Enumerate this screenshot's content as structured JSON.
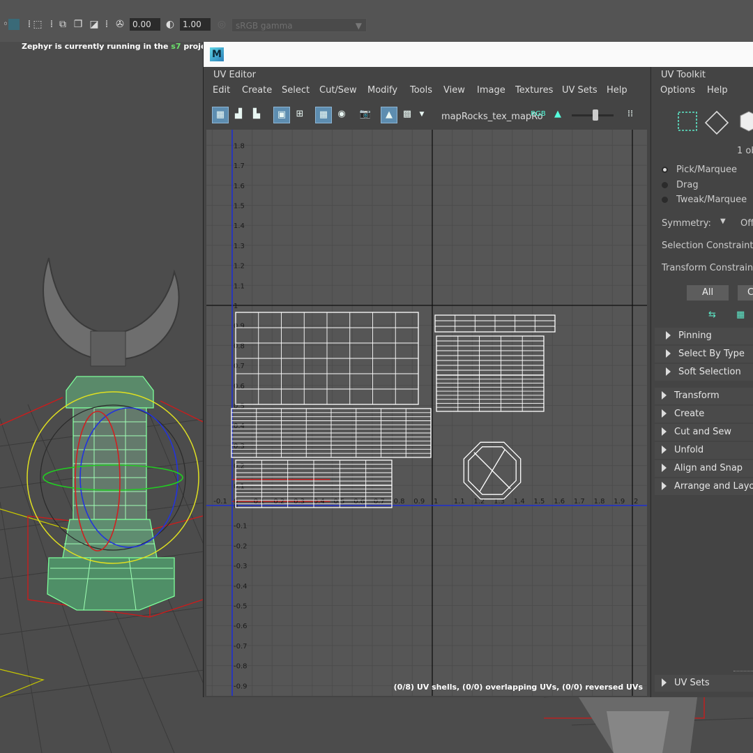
{
  "toolbar": {
    "value_a": "0.00",
    "value_b": "1.00",
    "color_space": "sRGB gamma"
  },
  "viewport": {
    "hud_message_pre": "Zephyr is currently running in the ",
    "hud_message_project": "s7",
    "hud_message_post": " project"
  },
  "uv_editor": {
    "title": "UV Editor",
    "menus": [
      "Edit",
      "Create",
      "Select",
      "Cut/Sew",
      "Modify",
      "Tools",
      "View",
      "Image",
      "Textures",
      "UV Sets",
      "Help"
    ],
    "texture_name": "mapRocks_tex_mapRo",
    "status": "(0/8) UV shells, (0/0) overlapping UVs, (0/0) reversed UVs",
    "v_axis_labels": [
      "1.8",
      "1.7",
      "1.6",
      "1.5",
      "1.4",
      "1.3",
      "1.2",
      "1.1",
      "1",
      "0.9",
      "0.8",
      "0.7",
      "0.6",
      "0.5",
      "0.4",
      "0.3",
      "0.2",
      "0.1",
      "0",
      "-0.1",
      "-0.2",
      "-0.3",
      "-0.4",
      "-0.5",
      "-0.6",
      "-0.7",
      "-0.8",
      "-0.9"
    ],
    "u_axis_labels": [
      "-0.1",
      "0",
      "0.1",
      "0.2",
      "0.3",
      "0.4",
      "0.5",
      "0.6",
      "0.7",
      "0.8",
      "0.9",
      "1",
      "1.1",
      "1.2",
      "1.3",
      "1.4",
      "1.5",
      "1.6",
      "1.7",
      "1.8",
      "1.9",
      "2"
    ]
  },
  "uv_toolkit": {
    "title": "UV Toolkit",
    "menus": [
      "Options",
      "Help"
    ],
    "selected_count": "1 ob",
    "modes": [
      {
        "label": "Pick/Marquee",
        "selected": true
      },
      {
        "label": "Drag",
        "selected": false
      },
      {
        "label": "Tweak/Marquee",
        "selected": false
      }
    ],
    "symmetry_label": "Symmetry:",
    "symmetry_value": "Off",
    "selection_constraint_label": "Selection Constraint:",
    "transform_constraint_label": "Transform Constraint:",
    "all_button": "All",
    "other_button": "C",
    "subsections": [
      "Pinning",
      "Select By Type",
      "Soft Selection"
    ],
    "sections": [
      "Transform",
      "Create",
      "Cut and Sew",
      "Unfold",
      "Align and Snap",
      "Arrange and Layo"
    ],
    "footer_section": "UV Sets"
  }
}
